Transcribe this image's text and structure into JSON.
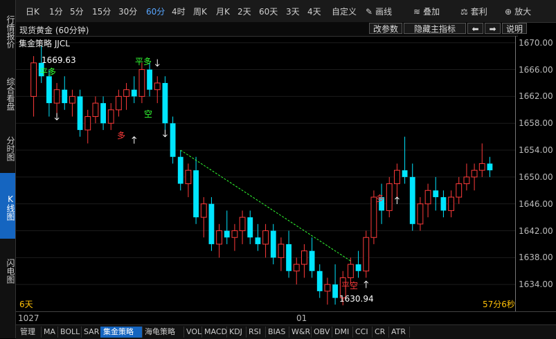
{
  "left_tabs": [
    {
      "label": "行情报价",
      "active": false
    },
    {
      "label": "综合看盘",
      "active": false
    },
    {
      "label": "分时图",
      "active": false
    },
    {
      "label": "K线图",
      "active": true
    },
    {
      "label": "闪电图",
      "active": false
    }
  ],
  "toolbar": {
    "periods": [
      "日K",
      "1分",
      "5分",
      "15分",
      "30分",
      "60分",
      "4时",
      "周K",
      "月K",
      "2天",
      "60天",
      "3天",
      "4天",
      "自定义"
    ],
    "active_period": "60分",
    "tools": [
      {
        "label": "画线",
        "icon": "pencil-icon"
      },
      {
        "label": "叠加",
        "icon": "layers-icon"
      },
      {
        "label": "套利",
        "icon": "arbitrage-icon"
      },
      {
        "label": "放大",
        "icon": "zoom-icon"
      }
    ]
  },
  "header": {
    "title": "现货黄金 (60分钟)",
    "buttons": [
      "改参数",
      "隐藏主指标",
      "⬅",
      "➡",
      "说明"
    ]
  },
  "strategy_label": "集金策略 JJCL",
  "annotations": {
    "high_label": "1669.63",
    "low_label": "1630.94",
    "period_left": "6天",
    "countdown": "57分6秒",
    "signals": [
      "平多",
      "多",
      "空",
      "平空",
      "多"
    ]
  },
  "y_axis": [
    "1670.00",
    "1666.00",
    "1662.00",
    "1658.00",
    "1654.00",
    "1650.00",
    "1646.00",
    "1642.00",
    "1638.00",
    "1634.00"
  ],
  "x_axis": [
    "1027",
    "01"
  ],
  "bottom_tabs": [
    "管理",
    "MA",
    "BOLL",
    "SAR",
    "集金策略",
    "海龟策略",
    "VOL",
    "MACD",
    "KDJ",
    "RSI",
    "BIAS",
    "W&R",
    "OBV",
    "DMI",
    "CCI",
    "CR",
    "ATR"
  ],
  "active_bottom_tab": "集金策略",
  "colors": {
    "up": "#ff3b3b",
    "down": "#00e5ff",
    "trend": "#33ff33",
    "signal_buy": "#ff3b3b",
    "signal_sell": "#33ff33"
  },
  "chart_data": {
    "type": "candlestick",
    "ylim": [
      1630,
      1671
    ],
    "ohlc": [
      [
        1662,
        1668,
        1659,
        1667
      ],
      [
        1667,
        1669.6,
        1664,
        1665
      ],
      [
        1665,
        1666,
        1659,
        1661
      ],
      [
        1661,
        1664,
        1659,
        1663
      ],
      [
        1663,
        1665,
        1660,
        1661
      ],
      [
        1661,
        1663,
        1659,
        1662
      ],
      [
        1662,
        1663,
        1656,
        1657
      ],
      [
        1657,
        1660,
        1655,
        1659
      ],
      [
        1659,
        1662,
        1658,
        1661
      ],
      [
        1661,
        1662,
        1657,
        1658
      ],
      [
        1658,
        1661,
        1657,
        1660
      ],
      [
        1660,
        1663,
        1659,
        1662
      ],
      [
        1662,
        1664,
        1660,
        1663
      ],
      [
        1663,
        1665,
        1661,
        1662
      ],
      [
        1662,
        1667,
        1661,
        1666
      ],
      [
        1666,
        1667,
        1662,
        1663
      ],
      [
        1663,
        1665,
        1661,
        1664
      ],
      [
        1664,
        1665,
        1657,
        1658
      ],
      [
        1658,
        1659,
        1652,
        1653
      ],
      [
        1653,
        1654,
        1648,
        1649
      ],
      [
        1649,
        1652,
        1647,
        1651
      ],
      [
        1651,
        1653,
        1643,
        1644
      ],
      [
        1644,
        1647,
        1641,
        1646
      ],
      [
        1646,
        1647,
        1639,
        1640
      ],
      [
        1640,
        1643,
        1638,
        1642
      ],
      [
        1642,
        1645,
        1640,
        1641
      ],
      [
        1641,
        1643,
        1639,
        1642
      ],
      [
        1642,
        1645,
        1640,
        1644
      ],
      [
        1644,
        1645,
        1640,
        1641
      ],
      [
        1641,
        1643,
        1639,
        1640
      ],
      [
        1640,
        1643,
        1638,
        1642
      ],
      [
        1642,
        1643,
        1637,
        1638
      ],
      [
        1638,
        1641,
        1636,
        1640
      ],
      [
        1640,
        1642,
        1635,
        1636
      ],
      [
        1636,
        1638,
        1634,
        1637
      ],
      [
        1637,
        1640,
        1635,
        1639
      ],
      [
        1639,
        1641,
        1635,
        1636
      ],
      [
        1636,
        1637,
        1632,
        1633
      ],
      [
        1633,
        1635,
        1631,
        1634
      ],
      [
        1634,
        1637,
        1631,
        1632
      ],
      [
        1632,
        1636,
        1630.9,
        1635
      ],
      [
        1635,
        1638,
        1634,
        1637
      ],
      [
        1637,
        1639,
        1635,
        1636
      ],
      [
        1636,
        1642,
        1635,
        1641
      ],
      [
        1641,
        1648,
        1640,
        1647
      ],
      [
        1647,
        1649,
        1643,
        1645
      ],
      [
        1645,
        1650,
        1644,
        1649
      ],
      [
        1649,
        1652,
        1647,
        1651
      ],
      [
        1651,
        1656,
        1649,
        1650
      ],
      [
        1650,
        1652,
        1642,
        1643
      ],
      [
        1643,
        1647,
        1642,
        1646
      ],
      [
        1646,
        1649,
        1644,
        1648
      ],
      [
        1648,
        1650,
        1645,
        1647
      ],
      [
        1647,
        1648,
        1644,
        1645
      ],
      [
        1645,
        1648,
        1644,
        1647
      ],
      [
        1647,
        1650,
        1646,
        1649
      ],
      [
        1649,
        1652,
        1648,
        1650
      ],
      [
        1650,
        1652,
        1648,
        1651
      ],
      [
        1651,
        1655,
        1650,
        1652
      ],
      [
        1652,
        1653,
        1650,
        1651
      ]
    ]
  }
}
